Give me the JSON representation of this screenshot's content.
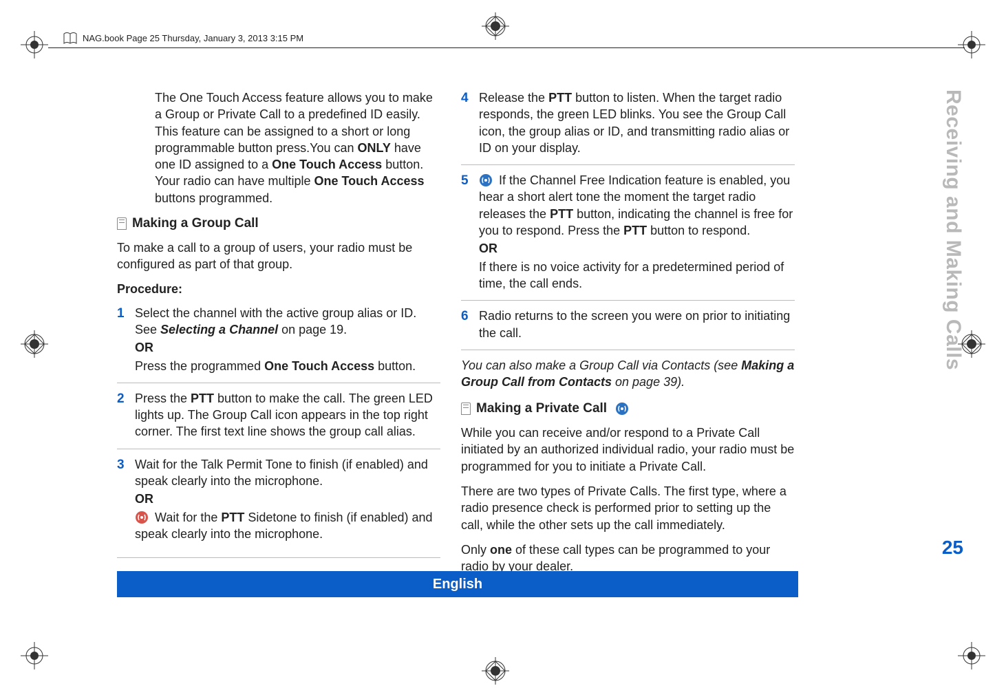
{
  "header": {
    "running_head": "NAG.book  Page 25  Thursday, January 3, 2013  3:15 PM"
  },
  "side": {
    "chapter_title": "Receiving and Making Calls",
    "page_number": "25"
  },
  "footer": {
    "language": "English"
  },
  "left": {
    "intro": "The One Touch Access feature allows you to make a Group or Private Call to a predefined ID easily. This feature can be assigned to a short or long programmable button press.You can ",
    "intro_only": "ONLY",
    "intro2": " have one ID assigned to a ",
    "intro_ota": "One Touch Access",
    "intro3": " button. Your radio can have multiple ",
    "intro_ota2": "One Touch Access",
    "intro4": " buttons programmed.",
    "section1_title": "Making a Group Call",
    "section1_body": "To make a call to a group of users, your radio must be configured as part of that group.",
    "procedure_label": "Procedure:",
    "steps": {
      "1": {
        "num": "1",
        "a": "Select the channel with the active group alias or ID. See ",
        "b": "Selecting a Channel",
        "c": " on page 19.",
        "or": "OR",
        "d": "Press the programmed ",
        "e": "One Touch Access",
        "f": " button."
      },
      "2": {
        "num": "2",
        "a": "Press the ",
        "b": "PTT",
        "c": " button to make the call. The green LED lights up. The Group Call icon appears in the top right corner. The first text line shows the group call alias."
      },
      "3": {
        "num": "3",
        "a": "Wait for the Talk Permit Tone to finish (if enabled) and speak clearly into the microphone.",
        "or": "OR",
        "b": " Wait for the ",
        "c": "PTT",
        "d": " Sidetone to finish (if enabled) and speak clearly into the microphone."
      }
    }
  },
  "right": {
    "steps": {
      "4": {
        "num": "4",
        "a": "Release the ",
        "b": "PTT",
        "c": " button to listen. When the target radio responds, the green LED blinks. You see the Group Call icon, the group alias or ID, and transmitting radio alias or ID on your display."
      },
      "5": {
        "num": "5",
        "a": " If the Channel Free Indication feature is enabled, you hear a short alert tone the moment the target radio releases the ",
        "b": "PTT",
        "c": " button, indicating the channel is free for you to respond. Press the ",
        "d": "PTT",
        "e": " button to respond.",
        "or": "OR",
        "f": "If there is no voice activity for a predetermined period of time, the call ends."
      },
      "6": {
        "num": "6",
        "a": "Radio returns to the screen you were on prior to initiating the call."
      }
    },
    "footnote_a": "You can also make a Group Call via Contacts (see ",
    "footnote_b": "Making a Group Call from Contacts",
    "footnote_c": " on page 39).",
    "section2_title": "Making a Private Call",
    "section2_p1": "While you can receive and/or respond to a Private Call initiated by an authorized individual radio, your radio must be programmed for you to initiate a Private Call.",
    "section2_p2": "There are two types of Private Calls. The first type, where a radio presence check is performed prior to setting up the call, while the other sets up the call immediately.",
    "section2_p3a": "Only ",
    "section2_p3b": "one",
    "section2_p3c": " of these call types can be programmed to your radio by your dealer."
  }
}
